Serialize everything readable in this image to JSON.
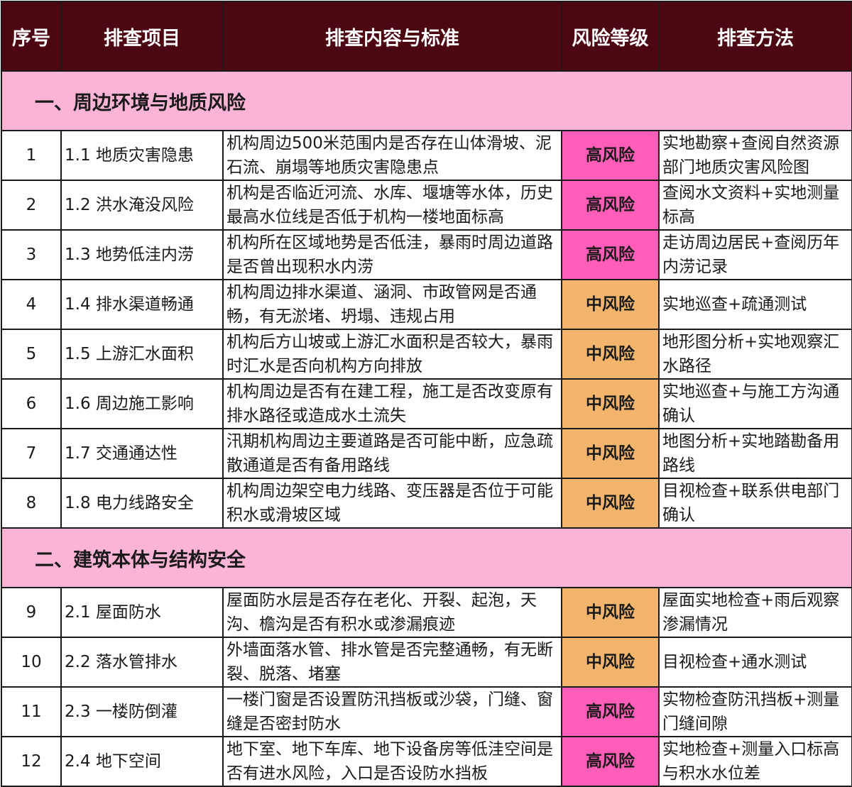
{
  "headers": {
    "no": "序号",
    "item": "排查项目",
    "content": "排查内容与标准",
    "risk": "风险等级",
    "method": "排查方法"
  },
  "colors": {
    "header_bg": "#4d0712",
    "section_bg": "#fbb3d6",
    "risk_high": "#ff5db8",
    "risk_mid": "#f2b56b"
  },
  "sections": [
    {
      "title": "一、周边环境与地质风险",
      "rows": [
        {
          "no": "1",
          "item": "1.1 地质灾害隐患",
          "content": "机构周边500米范围内是否存在山体滑坡、泥石流、崩塌等地质灾害隐患点",
          "risk": "高风险",
          "level": "high",
          "method": "实地勘察+查阅自然资源部门地质灾害风险图"
        },
        {
          "no": "2",
          "item": "1.2 洪水淹没风险",
          "content": "机构是否临近河流、水库、堰塘等水体，历史最高水位线是否低于机构一楼地面标高",
          "risk": "高风险",
          "level": "high",
          "method": "查阅水文资料+实地测量标高"
        },
        {
          "no": "3",
          "item": "1.3 地势低洼内涝",
          "content": "机构所在区域地势是否低洼，暴雨时周边道路是否曾出现积水内涝",
          "risk": "高风险",
          "level": "high",
          "method": "走访周边居民+查阅历年内涝记录"
        },
        {
          "no": "4",
          "item": "1.4 排水渠道畅通",
          "content": "机构周边排水渠道、涵洞、市政管网是否通畅，有无淤堵、坍塌、违规占用",
          "risk": "中风险",
          "level": "mid",
          "method": "实地巡查+疏通测试"
        },
        {
          "no": "5",
          "item": "1.5 上游汇水面积",
          "content": "机构后方山坡或上游汇水面积是否较大，暴雨时汇水是否向机构方向排放",
          "risk": "中风险",
          "level": "mid",
          "method": "地形图分析+实地观察汇水路径"
        },
        {
          "no": "6",
          "item": "1.6 周边施工影响",
          "content": "机构周边是否有在建工程，施工是否改变原有排水路径或造成水土流失",
          "risk": "中风险",
          "level": "mid",
          "method": "实地巡查+与施工方沟通确认"
        },
        {
          "no": "7",
          "item": "1.7 交通通达性",
          "content": "汛期机构周边主要道路是否可能中断，应急疏散通道是否有备用路线",
          "risk": "中风险",
          "level": "mid",
          "method": "地图分析+实地踏勘备用路线"
        },
        {
          "no": "8",
          "item": "1.8 电力线路安全",
          "content": "机构周边架空电力线路、变压器是否位于可能积水或滑坡区域",
          "risk": "中风险",
          "level": "mid",
          "method": "目视检查+联系供电部门确认"
        }
      ]
    },
    {
      "title": "二、建筑本体与结构安全",
      "rows": [
        {
          "no": "9",
          "item": "2.1 屋面防水",
          "content": "屋面防水层是否存在老化、开裂、起泡，天沟、檐沟是否有积水或渗漏痕迹",
          "risk": "中风险",
          "level": "mid",
          "method": "屋面实地检查+雨后观察渗漏情况"
        },
        {
          "no": "10",
          "item": "2.2 落水管排水",
          "content": "外墙面落水管、排水管是否完整通畅，有无断裂、脱落、堵塞",
          "risk": "中风险",
          "level": "mid",
          "method": "目视检查+通水测试"
        },
        {
          "no": "11",
          "item": "2.3 一楼防倒灌",
          "content": "一楼门窗是否设置防汛挡板或沙袋，门缝、窗缝是否密封防水",
          "risk": "高风险",
          "level": "high",
          "method": "实物检查防汛挡板+测量门缝间隙"
        },
        {
          "no": "12",
          "item": "2.4 地下空间",
          "content": "地下室、地下车库、地下设备房等低洼空间是否有进水风险，入口是否设防水挡板",
          "risk": "高风险",
          "level": "high",
          "method": "实地检查+测量入口标高与积水水位差"
        }
      ]
    }
  ]
}
